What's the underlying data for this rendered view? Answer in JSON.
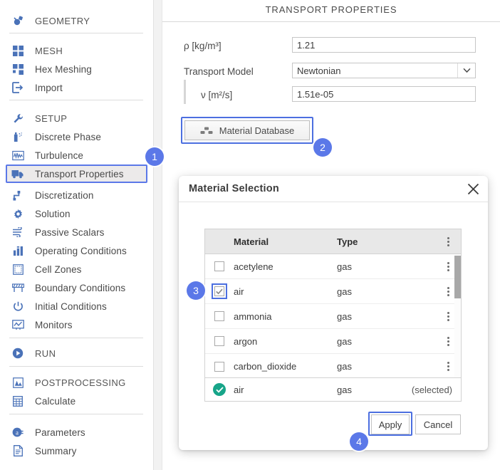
{
  "sidebar": {
    "items": [
      {
        "label": "GEOMETRY",
        "icon": "geometry-icon",
        "section": true
      },
      {
        "label": "MESH",
        "icon": "mesh-icon",
        "section": true
      },
      {
        "label": "Hex Meshing",
        "icon": "hex-meshing-icon",
        "section": false
      },
      {
        "label": "Import",
        "icon": "import-icon",
        "section": false
      },
      {
        "label": "SETUP",
        "icon": "wrench-icon",
        "section": true
      },
      {
        "label": "Discrete Phase",
        "icon": "spray-icon",
        "section": false
      },
      {
        "label": "Turbulence",
        "icon": "turbulence-icon",
        "section": false
      },
      {
        "label": "Transport Properties",
        "icon": "truck-icon",
        "section": false,
        "selected": true
      },
      {
        "label": "Discretization",
        "icon": "discretization-icon",
        "section": false
      },
      {
        "label": "Solution",
        "icon": "gear-icon",
        "section": false
      },
      {
        "label": "Passive Scalars",
        "icon": "passive-scalars-icon",
        "section": false
      },
      {
        "label": "Operating Conditions",
        "icon": "bar-chart-icon",
        "section": false
      },
      {
        "label": "Cell Zones",
        "icon": "cell-zones-icon",
        "section": false
      },
      {
        "label": "Boundary Conditions",
        "icon": "boundary-conditions-icon",
        "section": false
      },
      {
        "label": "Initial Conditions",
        "icon": "power-icon",
        "section": false
      },
      {
        "label": "Monitors",
        "icon": "monitor-icon",
        "section": false
      },
      {
        "label": "RUN",
        "icon": "play-icon",
        "section": true
      },
      {
        "label": "POSTPROCESSING",
        "icon": "postprocessing-icon",
        "section": true
      },
      {
        "label": "Calculate",
        "icon": "calculator-icon",
        "section": false
      },
      {
        "label": "Parameters",
        "icon": "parameters-icon",
        "section": false
      },
      {
        "label": "Summary",
        "icon": "summary-icon",
        "section": false
      }
    ]
  },
  "main": {
    "title": "TRANSPORT PROPERTIES",
    "fields": {
      "density_label": "ρ [kg/m³]",
      "density_value": "1.21",
      "transport_model_label": "Transport Model",
      "transport_model_value": "Newtonian",
      "viscosity_label": "ν [m²/s]",
      "viscosity_value": "1.51e-05"
    },
    "material_database_button": "Material Database"
  },
  "dialog": {
    "title": "Material Selection",
    "close_label": "✕",
    "table": {
      "columns": [
        "Material",
        "Type"
      ],
      "rows": [
        {
          "material": "acetylene",
          "type": "gas",
          "checked": false
        },
        {
          "material": "air",
          "type": "gas",
          "checked": true
        },
        {
          "material": "ammonia",
          "type": "gas",
          "checked": false
        },
        {
          "material": "argon",
          "type": "gas",
          "checked": false
        },
        {
          "material": "carbon_dioxide",
          "type": "gas",
          "checked": false
        }
      ]
    },
    "selected_row": {
      "material": "air",
      "type": "gas",
      "note": "(selected)"
    },
    "apply_label": "Apply",
    "cancel_label": "Cancel"
  },
  "badges": {
    "one": "1",
    "two": "2",
    "three": "3",
    "four": "4"
  },
  "colors": {
    "accent_blue": "#5b78e8",
    "icon_blue": "#4a72b8",
    "selected_green": "#17a589",
    "highlight_outline": "#4c6fe0"
  }
}
